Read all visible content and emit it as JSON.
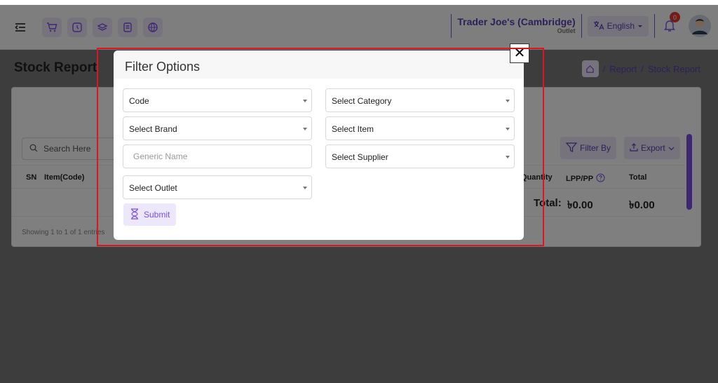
{
  "header": {
    "outlet_name": "Trader Joe's (Cambridge)",
    "outlet_label": "Outlet",
    "language": "English",
    "notification_count": "0",
    "icons": [
      "menu-toggle-icon",
      "cart-icon",
      "clock-icon",
      "layers-icon",
      "document-icon",
      "globe-icon",
      "translate-icon",
      "bell-icon"
    ]
  },
  "page": {
    "title": "Stock Report",
    "breadcrumb": [
      "/",
      "Report",
      "/",
      "Stock Report"
    ]
  },
  "card": {
    "search_placeholder": "Search Here",
    "filter_by_label": "Filter By",
    "export_label": "Export",
    "columns": [
      "SN",
      "Item(Code)",
      "Quantity",
      "LPP/PP",
      "Total"
    ],
    "total_label": "Total:",
    "totals": [
      "৳0.00",
      "৳0.00"
    ],
    "entries_text": "Showing 1 to 1 of 1 entries"
  },
  "modal": {
    "title": "Filter Options",
    "close_glyph": "✕",
    "fields": {
      "code": "Code",
      "category": "Select Category",
      "brand": "Select Brand",
      "item": "Select Item",
      "generic_placeholder": "Generic Name",
      "supplier": "Select Supplier",
      "outlet": "Select Outlet"
    },
    "submit_label": "Submit"
  },
  "colors": {
    "accent": "#7b4fe6",
    "accent_soft": "#ece7fb",
    "highlight_frame": "#e0141e"
  }
}
